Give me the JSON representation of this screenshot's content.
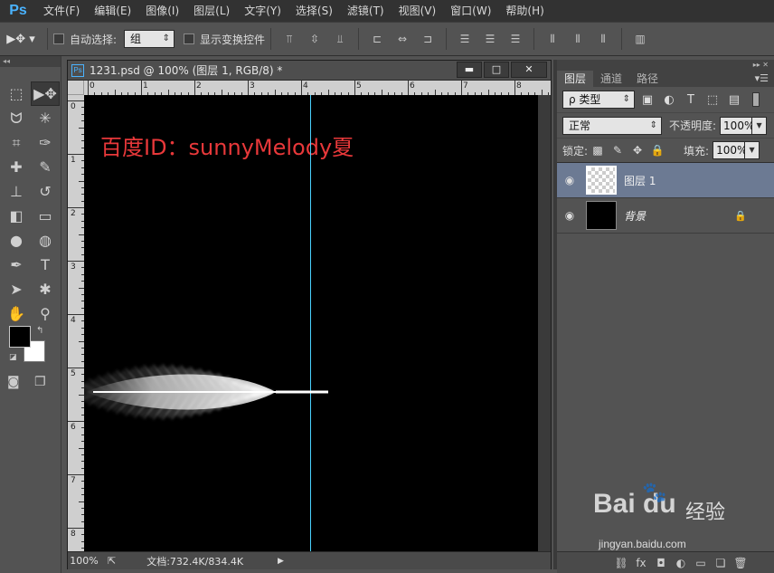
{
  "app": {
    "logo": "Ps"
  },
  "menu": [
    "文件(F)",
    "编辑(E)",
    "图像(I)",
    "图层(L)",
    "文字(Y)",
    "选择(S)",
    "滤镜(T)",
    "视图(V)",
    "窗口(W)",
    "帮助(H)"
  ],
  "options": {
    "auto_select_label": "自动选择:",
    "auto_select_value": "组",
    "show_transform_label": "显示变换控件"
  },
  "document": {
    "tab_title": "1231.psd @ 100% (图层 1, RGB/8) *",
    "ps_badge": "Ps",
    "canvas_text": "百度ID：sunnyMelody夏",
    "ruler_h": [
      "0",
      "1",
      "2",
      "3",
      "4",
      "5",
      "6",
      "7",
      "8"
    ],
    "ruler_v": [
      "0",
      "1",
      "2",
      "3",
      "4",
      "5",
      "6",
      "7",
      "8"
    ],
    "zoom": "100%",
    "doc_size": "文档:732.4K/834.4K"
  },
  "layers_panel": {
    "tabs": [
      "图层",
      "通道",
      "路径"
    ],
    "filter_type": "ρ 类型",
    "blend_mode": "正常",
    "opacity_label": "不透明度:",
    "opacity_value": "100%",
    "lock_label": "锁定:",
    "fill_label": "填充:",
    "fill_value": "100%",
    "layers": [
      {
        "name": "图层 1",
        "selected": true
      },
      {
        "name": "背景",
        "selected": false
      }
    ]
  },
  "watermark": {
    "logo": "Bai du",
    "cn": "经验",
    "url": "jingyan.baidu.com"
  }
}
